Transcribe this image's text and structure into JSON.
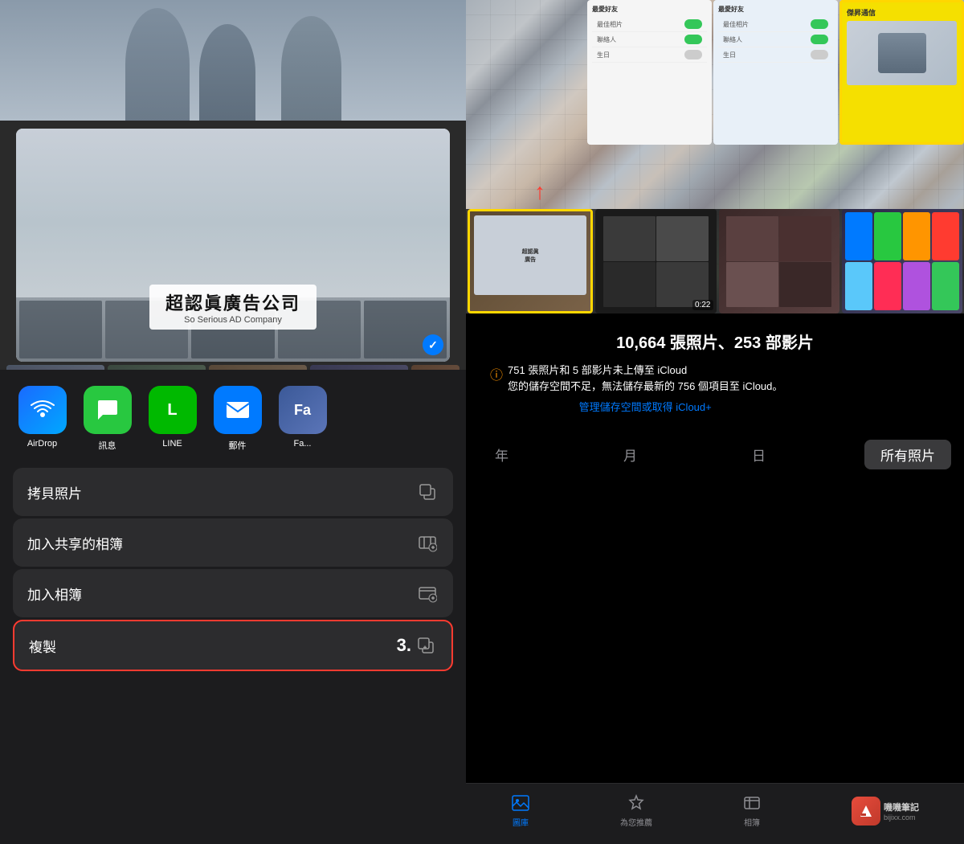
{
  "leftPanel": {
    "mainPhoto": {
      "titleZh": "超認眞廣告公司",
      "titleEn": "So Serious AD Company"
    },
    "shareIcons": [
      {
        "id": "airdrop",
        "label": "AirDrop",
        "colorClass": "airdrop-icon"
      },
      {
        "id": "messages",
        "label": "訊息",
        "colorClass": "messages-icon"
      },
      {
        "id": "line",
        "label": "LINE",
        "colorClass": "line-icon"
      },
      {
        "id": "mail",
        "label": "郵件",
        "colorClass": "mail-icon"
      },
      {
        "id": "fa",
        "label": "Fa",
        "colorClass": "fa-icon"
      }
    ],
    "actions": [
      {
        "id": "copy-photo",
        "label": "拷貝照片",
        "icon": "copy",
        "highlighted": false
      },
      {
        "id": "add-shared-album",
        "label": "加入共享的相簿",
        "icon": "shared-album",
        "highlighted": false
      },
      {
        "id": "add-album",
        "label": "加入相簿",
        "icon": "album",
        "highlighted": false
      },
      {
        "id": "duplicate",
        "label": "複製",
        "icon": "duplicate",
        "highlighted": true,
        "stepNumber": "3."
      }
    ]
  },
  "rightPanel": {
    "miniCards": [
      {
        "id": "settings-card-1",
        "highlighted": false,
        "rows": [
          "最愛好友",
          "最佳相片",
          "聯絡人"
        ]
      },
      {
        "id": "settings-card-2",
        "highlighted": false,
        "rows": [
          "最愛好友",
          "最佳相片",
          "聯絡人"
        ]
      },
      {
        "id": "jie-sheng-card",
        "label": "傑昇通信",
        "highlighted": true
      }
    ],
    "statsTitle": "10,664 張照片、253 部影片",
    "warningIcon": "⚠",
    "warningText": "751 張照片和 5 部影片未上傳至 iCloud\n您的儲存空間不足，無法儲存最新的 756 個項目至 iCloud。",
    "icloudLink": "管理儲存空間或取得 iCloud+",
    "timeTabs": [
      "年",
      "月",
      "日",
      "所有照片"
    ],
    "activeTab": "所有照片",
    "navItems": [
      {
        "id": "library",
        "label": "圖庫",
        "icon": "🖼",
        "active": true
      },
      {
        "id": "for-you",
        "label": "為您推薦",
        "icon": "⭐",
        "active": false
      },
      {
        "id": "albums",
        "label": "相簿",
        "icon": "📁",
        "active": false
      }
    ],
    "videoDuration": "0:22",
    "redArrow": "↑"
  }
}
